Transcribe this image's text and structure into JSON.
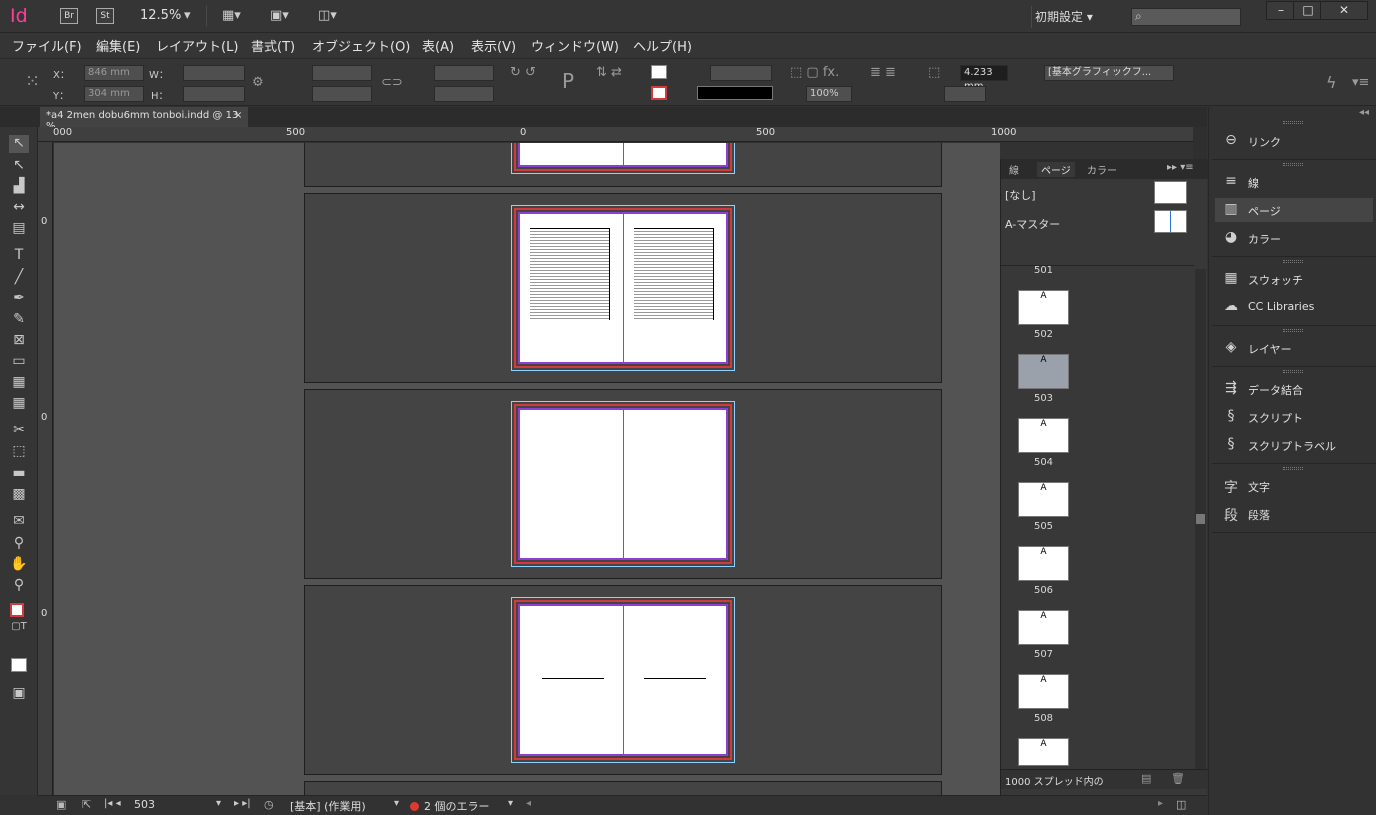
{
  "app": {
    "logo": "Id",
    "bridge": "Br",
    "stock": "St",
    "zoom": "12.5%",
    "workspace": "初期設定",
    "window_buttons": [
      "–",
      "□",
      "✕"
    ]
  },
  "menu": [
    "ファイル(F)",
    "編集(E)",
    "レイアウト(L)",
    "書式(T)",
    "オブジェクト(O)",
    "表(A)",
    "表示(V)",
    "ウィンドウ(W)",
    "ヘルプ(H)"
  ],
  "control": {
    "x_label": "X：",
    "y_label": "Y：",
    "x_value": "846 mm",
    "y_value": "304 mm",
    "w_label": "W：",
    "h_label": "H：",
    "stroke_weight": "4.233 mm",
    "opacity": "100%",
    "object_style": "[基本グラフィックフ..."
  },
  "document": {
    "tab_title": "*a4 2men dobu6mm tonboi.indd @ 13 %",
    "close": "×"
  },
  "ruler": {
    "h_ticks": [
      "000",
      "500",
      "0",
      "500",
      "1000"
    ],
    "v_ticks": [
      "0",
      "0",
      "0"
    ]
  },
  "pages_panel": {
    "tabs": [
      "線",
      "ページ",
      "カラー"
    ],
    "masters": [
      "[なし]",
      "A-マスター"
    ],
    "pages": [
      "501",
      "502",
      "503",
      "504",
      "505",
      "506",
      "507",
      "508"
    ],
    "thumb_letter": "A",
    "footer": "1000 スプレッド内の"
  },
  "dock": {
    "items": [
      {
        "icon": "link-icon",
        "label": "リンク"
      },
      {
        "icon": "stroke-icon",
        "label": "線"
      },
      {
        "icon": "pages-icon",
        "label": "ページ"
      },
      {
        "icon": "color-icon",
        "label": "カラー"
      },
      {
        "icon": "swatches-icon",
        "label": "スウォッチ"
      },
      {
        "icon": "cc-libraries-icon",
        "label": "CC Libraries"
      },
      {
        "icon": "layers-icon",
        "label": "レイヤー"
      },
      {
        "icon": "data-merge-icon",
        "label": "データ結合"
      },
      {
        "icon": "scripts-icon",
        "label": "スクリプト"
      },
      {
        "icon": "script-label-icon",
        "label": "スクリプトラベル"
      },
      {
        "icon": "character-icon",
        "label": "文字"
      },
      {
        "icon": "paragraph-icon",
        "label": "段落"
      }
    ],
    "glyphs": {
      "character": "字",
      "paragraph": "段"
    }
  },
  "status": {
    "page": "503",
    "master": "[基本] (作業用)",
    "errors": "2 個のエラー"
  },
  "colors": {
    "indesign_pink": "#ff3d9a",
    "bleed_red": "#d23b3b",
    "margin_purple": "#8e3fd3",
    "spine_blue": "#2a74d4",
    "error_red": "#e03a2e"
  }
}
